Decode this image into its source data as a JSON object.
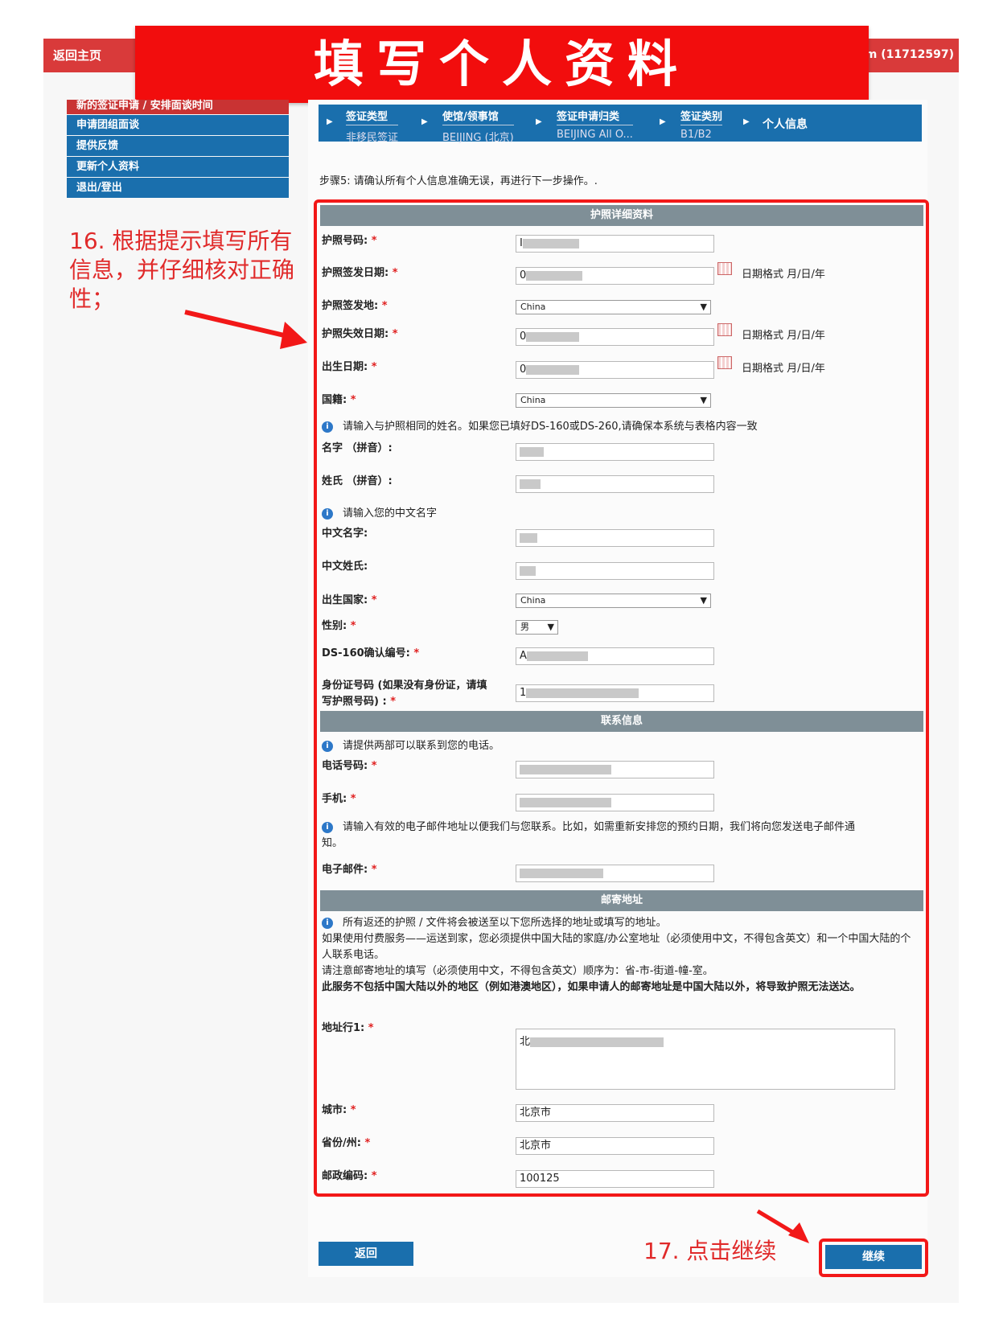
{
  "header": {
    "home": "返回主页",
    "user": "om (11712597)"
  },
  "banner": "填写个人资料",
  "leftnav": [
    "新的签证申请 / 安排面谈时间",
    "申请团组面谈",
    "提供反馈",
    "更新个人资料",
    "退出/登出"
  ],
  "annotations": {
    "a16": "16. 根据提示填写所有信息，并仔细核对正确性；",
    "a17": "17. 点击继续"
  },
  "breadcrumb": [
    {
      "title": "签证类型",
      "value": "非移民签证"
    },
    {
      "title": "使馆/领事馆",
      "value": "BEIJING (北京)"
    },
    {
      "title": "签证申请归类",
      "value": "BEIJING All O..."
    },
    {
      "title": "签证类别",
      "value": "B1/B2"
    },
    {
      "title": "个人信息",
      "value": ""
    }
  ],
  "step": "步骤5: 请确认所有个人信息准确无误，再进行下一步操作。.",
  "passport": {
    "section": "护照详细资料",
    "number_label": "护照号码:",
    "number_value": "I",
    "issue_date_label": "护照签发日期:",
    "issue_date_value": "0",
    "issue_place_label": "护照签发地:",
    "issue_place_value": "China",
    "expiry_label": "护照失效日期:",
    "expiry_value": "0",
    "birth_label": "出生日期:",
    "birth_value": "0",
    "nationality_label": "国籍:",
    "nationality_value": "China",
    "date_format": "日期格式 月/日/年",
    "name_info": "请输入与护照相同的姓名。如果您已填好DS-160或DS-260,请确保本系统与表格内容一致",
    "given_name_label": "名字 （拼音）:",
    "surname_label": "姓氏 （拼音）:",
    "cn_info": "请输入您的中文名字",
    "cn_given_label": "中文名字:",
    "cn_surname_label": "中文姓氏:",
    "birth_country_label": "出生国家:",
    "birth_country_value": "China",
    "gender_label": "性别:",
    "gender_value": "男",
    "ds160_label": "DS-160确认编号:",
    "ds160_value": "A",
    "id_label_1": "身份证号码 (如果没有身份证，请填",
    "id_label_2": "写护照号码) :",
    "id_value": "1"
  },
  "contact": {
    "section": "联系信息",
    "phone_info": "请提供两部可以联系到您的电话。",
    "phone_label": "电话号码:",
    "mobile_label": "手机:",
    "email_info_1": "请输入有效的电子邮件地址以便我们与您联系。比如，如需重新安排您的预约日期，我们将向您发送电子邮件通",
    "email_info_2": "知。",
    "email_label": "电子邮件:"
  },
  "mailing": {
    "section": "邮寄地址",
    "p1": "所有返还的护照 / 文件将会被送至以下您所选择的地址或填写的地址。",
    "p2": "如果使用付费服务——运送到家，您必须提供中国大陆的家庭/办公室地址（必须使用中文，不得包含英文）和一个中国大陆的个人联系电话。",
    "p3": "请注意邮寄地址的填写（必须使用中文，不得包含英文）顺序为：省-市-街道-幢-室。",
    "p4": "此服务不包括中国大陆以外的地区（例如港澳地区），如果申请人的邮寄地址是中国大陆以外，将导致护照无法送达。",
    "addr_label": "地址行1:",
    "addr_value": "北",
    "city_label": "城市:",
    "city_value": "北京市",
    "province_label": "省份/州:",
    "province_value": "北京市",
    "zip_label": "邮政编码:",
    "zip_value": "100125"
  },
  "buttons": {
    "back": "返回",
    "continue": "继续"
  }
}
